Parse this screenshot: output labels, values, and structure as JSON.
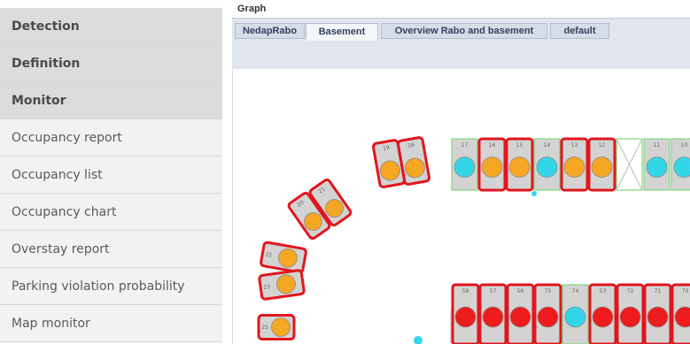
{
  "sidebar": {
    "items": [
      {
        "label": "Detection",
        "kind": "section"
      },
      {
        "label": "Definition",
        "kind": "section"
      },
      {
        "label": "Monitor",
        "kind": "section"
      },
      {
        "label": "Occupancy report",
        "kind": "sub"
      },
      {
        "label": "Occupancy list",
        "kind": "sub"
      },
      {
        "label": "Occupancy chart",
        "kind": "sub"
      },
      {
        "label": "Overstay report",
        "kind": "sub"
      },
      {
        "label": "Parking violation probability",
        "kind": "sub"
      },
      {
        "label": "Map monitor",
        "kind": "sub"
      }
    ]
  },
  "graph": {
    "title": "Graph",
    "tabs": [
      {
        "label": "NedapRabo",
        "active": false
      },
      {
        "label": "Basement",
        "active": true
      },
      {
        "label": "Overview Rabo and basement",
        "active": false
      },
      {
        "label": "default",
        "active": false
      }
    ]
  },
  "parking_map": {
    "colors": {
      "orange_occupied": "#f5a623",
      "red_overstay": "#ee1c1c",
      "cyan_free": "#33d6e8",
      "alert_border": "#e0161e",
      "ok_border": "#7ed87e",
      "bay_fill": "#d3d3d3"
    },
    "upper_row": [
      {
        "label": "17",
        "status": "cyan_free",
        "border": "ok"
      },
      {
        "label": "16",
        "status": "orange_occupied",
        "border": "alert"
      },
      {
        "label": "15",
        "status": "orange_occupied",
        "border": "alert"
      },
      {
        "label": "14",
        "status": "cyan_free",
        "border": "ok"
      },
      {
        "label": "13",
        "status": "orange_occupied",
        "border": "alert"
      },
      {
        "label": "12",
        "status": "orange_occupied",
        "border": "alert"
      },
      {
        "label": "",
        "status": "empty",
        "border": "ok"
      },
      {
        "label": "11",
        "status": "cyan_free",
        "border": "ok"
      },
      {
        "label": "10",
        "status": "cyan_free",
        "border": "ok"
      }
    ],
    "lower_row": [
      {
        "label": "58",
        "status": "red_overstay",
        "border": "alert"
      },
      {
        "label": "57",
        "status": "red_overstay",
        "border": "alert"
      },
      {
        "label": "56",
        "status": "red_overstay",
        "border": "alert"
      },
      {
        "label": "75",
        "status": "red_overstay",
        "border": "alert"
      },
      {
        "label": "74",
        "status": "cyan_free",
        "border": "ok"
      },
      {
        "label": "53",
        "status": "red_overstay",
        "border": "alert"
      },
      {
        "label": "72",
        "status": "red_overstay",
        "border": "alert"
      },
      {
        "label": "71",
        "status": "red_overstay",
        "border": "alert"
      },
      {
        "label": "70",
        "status": "red_overstay",
        "border": "alert"
      }
    ],
    "curve_bays": [
      {
        "label": "19",
        "status": "orange_occupied"
      },
      {
        "label": "18",
        "status": "orange_occupied"
      },
      {
        "label": "20",
        "status": "orange_occupied"
      },
      {
        "label": "21",
        "status": "orange_occupied"
      },
      {
        "label": "22",
        "status": "orange_occupied"
      },
      {
        "label": "23",
        "status": "orange_occupied"
      },
      {
        "label": "25",
        "status": "orange_occupied"
      }
    ]
  }
}
